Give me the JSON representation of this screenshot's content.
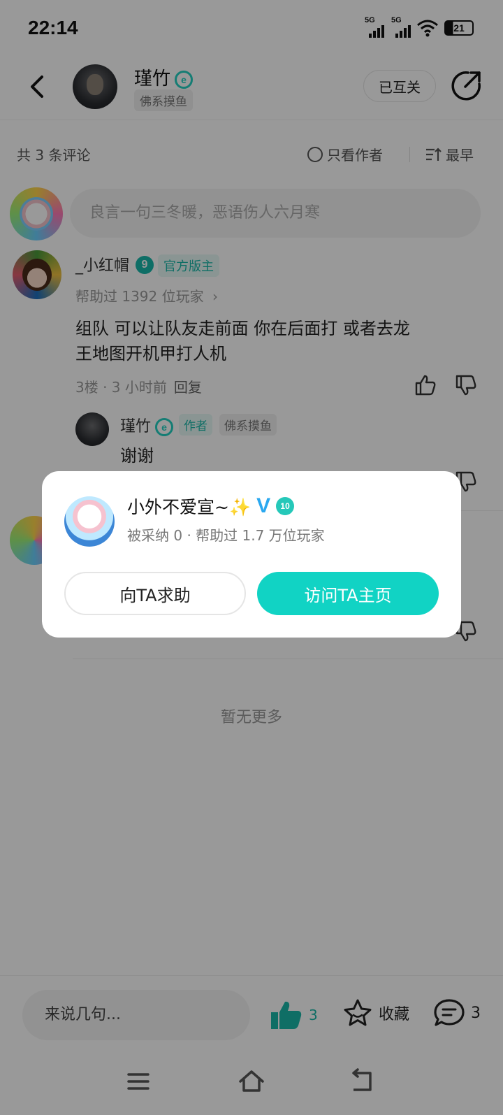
{
  "status": {
    "time": "22:14",
    "sim1": "5G",
    "sim2": "5G",
    "battery": "21"
  },
  "header": {
    "user_name": "瑾竹",
    "level_badge": "e",
    "user_tag": "佛系摸鱼",
    "follow_label": "已互关"
  },
  "filters": {
    "count_text": "共 3 条评论",
    "author_only": "只看作者",
    "sort": "最早"
  },
  "comment_input": {
    "placeholder": "良言一句三冬暖，恶语伤人六月寒"
  },
  "comments": [
    {
      "name": "_小红帽",
      "level": "9",
      "role_tag": "官方版主",
      "helped": "帮助过 1392 位玩家",
      "text_line1": "组队 可以让队友走前面 你在后面打  或者去龙",
      "text_line2": "王地图开机甲打人机",
      "meta": "3楼 · 3 小时前",
      "reply": "回复"
    },
    {
      "name": "瑾竹",
      "level": "e",
      "author_tag": "作者",
      "user_tag": "佛系摸鱼",
      "text": "谢谢"
    }
  ],
  "no_more": "暂无更多",
  "bottom_bar": {
    "say_placeholder": "来说几句...",
    "like_count": "3",
    "fav_label": "收藏",
    "comment_count": "3"
  },
  "popup": {
    "name": "小外不爱宣~✨",
    "verified": "V",
    "level": "10",
    "subtitle": "被采纳 0 · 帮助过 1.7 万位玩家",
    "help_button": "向TA求助",
    "visit_button": "访问TA主页"
  },
  "colors": {
    "accent": "#11d3c4",
    "overlay": "rgba(0,0,0,0.40)"
  }
}
